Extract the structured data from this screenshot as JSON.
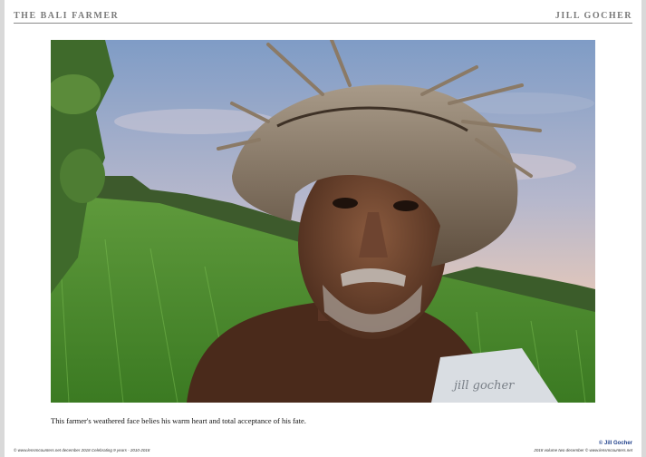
{
  "header": {
    "left_title": "THE BALI FARMER",
    "right_title": "JILL GOCHER"
  },
  "photo": {
    "description_icon": "portrait-photo",
    "signature": "jill gocher"
  },
  "caption": "This farmer's weathered face belies his warm heart and total acceptance of his fate.",
  "footer": {
    "left": "© www.lensmcounters.net december 2018 Celebrating 9 years - 2010-2018",
    "right": "2018 volume two december © www.lensmcounters.net",
    "copyright": "© Jill Gocher"
  },
  "colors": {
    "header_text": "#7a7a7a",
    "copyright": "#1e3f8a"
  }
}
